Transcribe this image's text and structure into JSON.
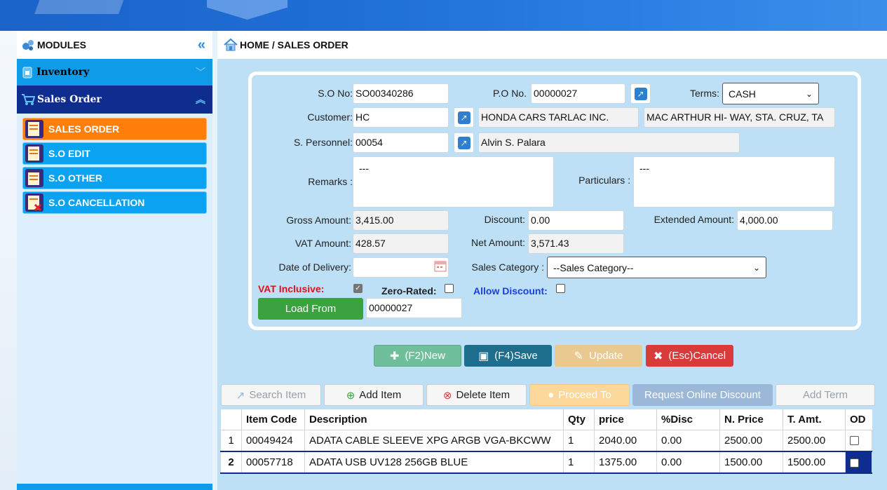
{
  "sidebar": {
    "title": "MODULES",
    "inventory_label": "Inventory",
    "sales_order_label": "Sales Order",
    "items": [
      {
        "label": "SALES ORDER"
      },
      {
        "label": "S.O EDIT"
      },
      {
        "label": "S.O OTHER"
      },
      {
        "label": "S.O CANCELLATION"
      }
    ]
  },
  "breadcrumb": "HOME / SALES ORDER",
  "form": {
    "so_no_label": "S.O No:",
    "so_no": "SO00340286",
    "po_no_label": "P.O No.",
    "po_no": "00000027",
    "terms_label": "Terms:",
    "terms": "CASH",
    "customer_label": "Customer:",
    "customer_code": "HC",
    "customer_name": "HONDA CARS TARLAC INC.",
    "customer_address": "MAC ARTHUR HI- WAY, STA. CRUZ, TA",
    "personnel_label": "S. Personnel:",
    "personnel_code": "00054",
    "personnel_name": "Alvin S. Palara",
    "remarks_label": "Remarks :",
    "remarks": "---",
    "particulars_label": "Particulars :",
    "particulars": "---",
    "gross_label": "Gross Amount:",
    "gross": "3,415.00",
    "discount_label": "Discount:",
    "discount": "0.00",
    "extended_label": "Extended Amount:",
    "extended": "4,000.00",
    "vat_label": "VAT Amount:",
    "vat": "428.57",
    "net_label": "Net Amount:",
    "net": "3,571.43",
    "delivery_label": "Date of Delivery:",
    "delivery": "",
    "sales_cat_label": "Sales Category :",
    "sales_cat": "--Sales Category--",
    "vat_inclusive_label": "VAT Inclusive:",
    "zero_rated_label": "Zero-Rated:",
    "allow_discount_label": "Allow Discount:",
    "load_from_label": "Load From",
    "load_from": "00000027"
  },
  "actions": {
    "new": "(F2)New",
    "save": "(F4)Save",
    "update": "Update",
    "cancel": "(Esc)Cancel"
  },
  "toolbar": {
    "search": "Search Item",
    "add": "Add Item",
    "delete": "Delete Item",
    "proceed": "Proceed To",
    "request": "Request Online Discount",
    "term": "Add Term"
  },
  "table": {
    "headers": [
      "Item Code",
      "Description",
      "Qty",
      "price",
      "%Disc",
      "N. Price",
      "T. Amt.",
      "OD"
    ],
    "rows": [
      {
        "num": "1",
        "code": "00049424",
        "desc": "ADATA CABLE SLEEVE XPG ARGB VGA-BKCWW",
        "qty": "1",
        "price": "2040.00",
        "disc": "0.00",
        "nprice": "2500.00",
        "tamt": "2500.00"
      },
      {
        "num": "2",
        "code": "00057718",
        "desc": "ADATA USB UV128 256GB BLUE",
        "qty": "1",
        "price": "1375.00",
        "disc": "0.00",
        "nprice": "1500.00",
        "tamt": "1500.00"
      }
    ]
  },
  "colors": {
    "active_item": "#ff7f0a",
    "sidebar_item": "#0aa3f2",
    "sales_order_header": "#0e2d8f",
    "new_btn": "#5fbf8d",
    "save_btn": "#1d6e8c",
    "update_btn": "#e9c98f",
    "cancel_btn": "#d93a3a"
  }
}
